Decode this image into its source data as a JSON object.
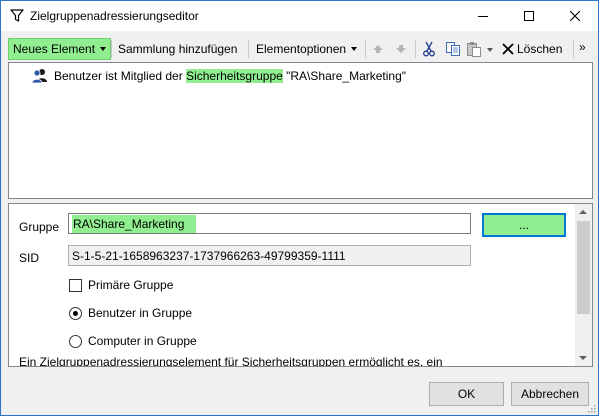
{
  "window": {
    "title": "Zielgruppenadressierungseditor",
    "icon": "filter-icon"
  },
  "toolbar": {
    "new_element": "Neues Element",
    "add_collection": "Sammlung hinzufügen",
    "element_options": "Elementoptionen",
    "delete": "Löschen",
    "overflow": "»"
  },
  "tree": {
    "item_prefix": "Benutzer ist Mitglied der ",
    "item_highlight": "Sicherheitsgruppe",
    "item_suffix": " \"RA\\Share_Marketing\""
  },
  "properties": {
    "group_label": "Gruppe",
    "group_value": "RA\\Share_Marketing",
    "browse_button": "...",
    "sid_label": "SID",
    "sid_value": "S-1-5-21-1658963237-1737966263-49799359-1111",
    "primary_group_label": "Primäre Gruppe",
    "primary_group_checked": false,
    "radio_users": "Benutzer in Gruppe",
    "radio_computers": "Computer in Gruppe",
    "selected_radio": "users",
    "description": "Ein Zielgruppenadressierungselement für Sicherheitsgruppen ermöglicht es, ein"
  },
  "buttons": {
    "ok": "OK",
    "cancel": "Abbrechen"
  },
  "colors": {
    "highlight": "#90ee90",
    "focus_border": "#0078d7",
    "window_border": "#2b73c9"
  }
}
